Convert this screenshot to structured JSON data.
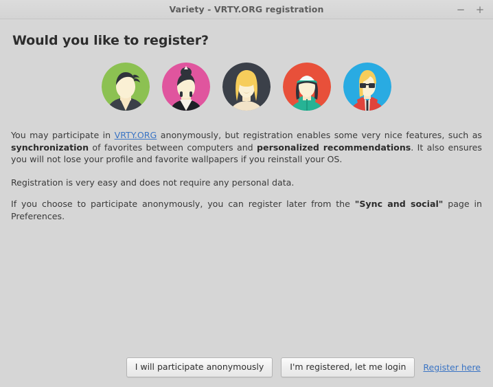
{
  "window": {
    "title": "Variety - VRTY.ORG registration",
    "controls": [
      {
        "name": "minimize",
        "glyph": "−"
      },
      {
        "name": "maximize",
        "glyph": "+"
      }
    ]
  },
  "heading": "Would you like to register?",
  "avatars": [
    {
      "label": "avatar-green-dark-hair",
      "bg": "#8cc152",
      "hair": "#2f333b",
      "skin": "#f7e6c4",
      "clothes": "#3b4049"
    },
    {
      "label": "avatar-pink-bun-hair",
      "bg": "#e0559e",
      "hair": "#2f333b",
      "skin": "#f7e6c4",
      "clothes": "#1e2126"
    },
    {
      "label": "avatar-dark-blonde-hair",
      "bg": "#3b4049",
      "hair": "#f5c council",
      "skin": "#f7e6c4",
      "clothes": "#f2e3c8"
    },
    {
      "label": "avatar-red-green-cap",
      "bg": "#e8503a",
      "hair": "#2f333b",
      "skin": "#f7e6c4",
      "clothes": "#27b395"
    },
    {
      "label": "avatar-blue-sunglasses",
      "bg": "#29abe2",
      "hair": "#f6cd5b",
      "skin": "#f7e6c4",
      "clothes": "#e0443c"
    }
  ],
  "paragraphs": {
    "p1": {
      "seg1": "You may participate in ",
      "link": "VRTY.ORG",
      "seg2": " anonymously, but registration enables some very nice features, such as ",
      "bold1": "synchronization",
      "seg3": " of favorites between computers and ",
      "bold2": "personalized recommendations",
      "seg4": ". It also ensures you will not lose your profile and favorite wallpapers if you reinstall your OS."
    },
    "p2": "Registration is very easy and does not require any personal data.",
    "p3": {
      "seg1": "If you choose to participate anonymously, you can register later from the ",
      "bold1": "\"Sync and social\"",
      "seg2": " page in Preferences."
    }
  },
  "footer": {
    "anonymous_button": "I will participate anonymously",
    "login_button": "I'm registered, let me login",
    "register_link": "Register here"
  },
  "colors": {
    "window_bg": "#d6d6d6",
    "link": "#3a74c4",
    "text": "#3a3a3a",
    "heading": "#2d2d2d"
  }
}
